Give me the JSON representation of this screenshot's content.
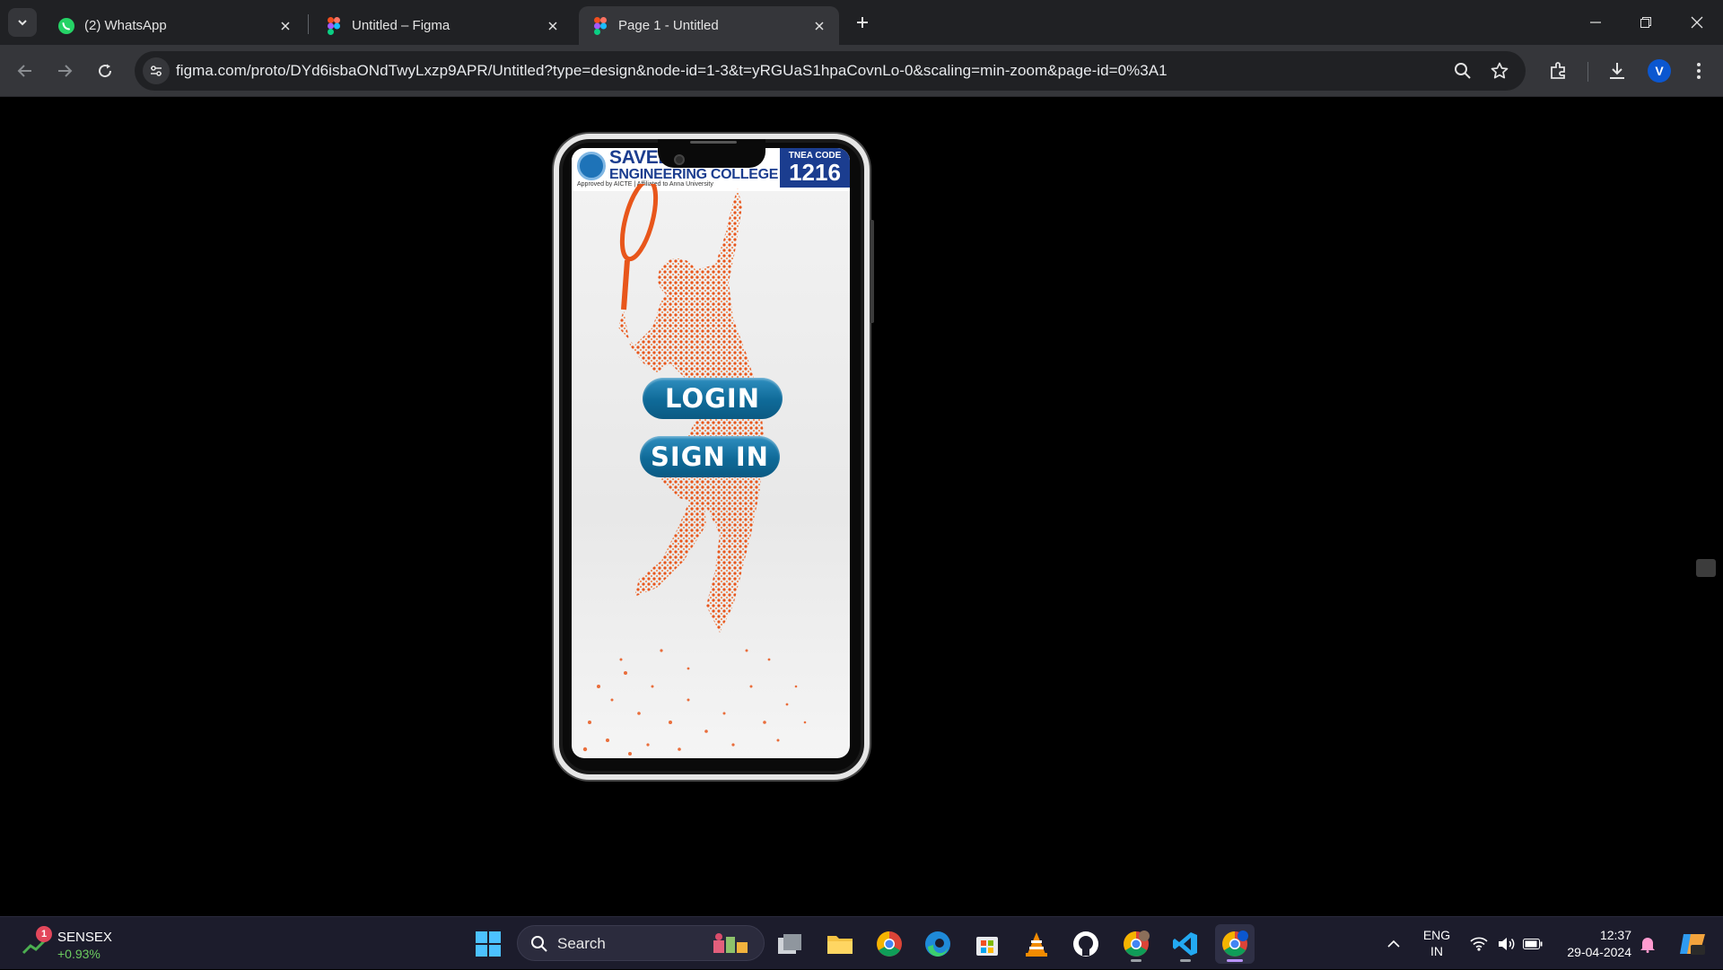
{
  "browser": {
    "tabs": [
      {
        "title": "(2) WhatsApp",
        "icon": "whatsapp-icon",
        "active": false
      },
      {
        "title": "Untitled – Figma",
        "icon": "figma-icon",
        "active": false
      },
      {
        "title": "Page 1 - Untitled",
        "icon": "figma-icon",
        "active": true
      }
    ],
    "url": "figma.com/proto/DYd6isbaONdTwyLxzp9APR/Untitled?type=design&node-id=1-3&t=yRGUaS1hpaCovnLo-0&scaling=min-zoom&page-id=0%3A1",
    "profile_initial": "V"
  },
  "prototype": {
    "college": {
      "name_line1": "SAVEETHA",
      "name_line2": "ENGINEERING COLLEGE",
      "subtitle": "Approved by AICTE | Affiliated to Anna University",
      "tnea_label": "TNEA CODE",
      "tnea_code": "1216"
    },
    "buttons": {
      "login": "LOGIN",
      "sign_in": "SIGN IN"
    },
    "accent_orange": "#e8561b",
    "button_blue": "#0f6a98"
  },
  "taskbar": {
    "widget": {
      "badge": "1",
      "name": "SENSEX",
      "value": "+0.93%"
    },
    "search_placeholder": "Search",
    "language": {
      "line1": "ENG",
      "line2": "IN"
    },
    "clock": {
      "time": "12:37",
      "date": "29-04-2024"
    }
  }
}
